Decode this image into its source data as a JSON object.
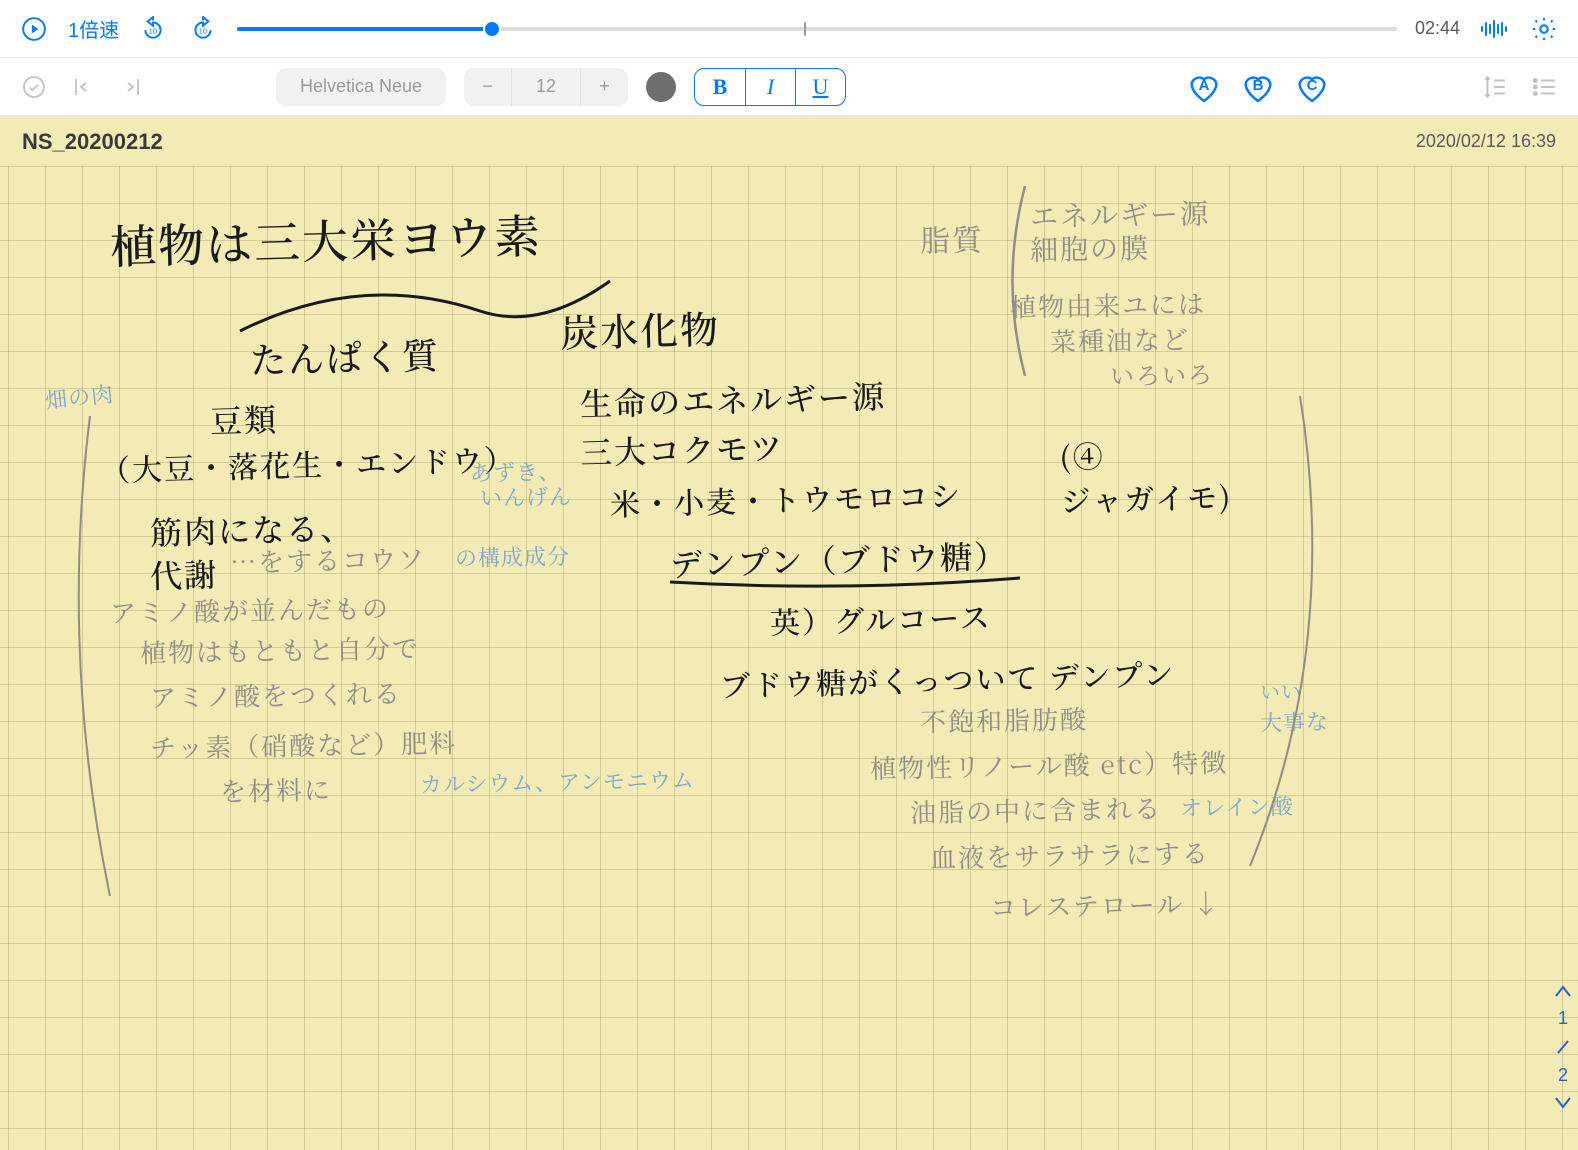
{
  "playback": {
    "speed_label": "1倍速",
    "time_label": "02:44",
    "progress_percent": 22,
    "marker_percent": 49
  },
  "format": {
    "font_name": "Helvetica Neue",
    "font_size": "12",
    "bold_label": "B",
    "italic_label": "I",
    "underline_label": "U",
    "heart_a": "A",
    "heart_b": "B",
    "heart_c": "C"
  },
  "note": {
    "title": "NS_20200212",
    "timestamp": "2020/02/12 16:39"
  },
  "handwriting": {
    "title": "植物は三大栄ヨウ素",
    "protein_label": "たんぱく質",
    "carb_label": "炭水化物",
    "beans": "豆類",
    "beans_examples": "（大豆・落花生・エンドウ）",
    "muscle": "筋肉になる、",
    "metabolism": "代謝",
    "energy_source": "生命のエネルギー源",
    "three_grains": "三大コクモツ",
    "grains_examples": "米・小麦・トウモロコシ",
    "potato": "ジャガイモ",
    "starch": "デンプン（ブドウ糖）",
    "glucose_en": "英）グルコース",
    "glucose_chain": "ブドウ糖がくっついて デンプン"
  },
  "pencil": {
    "fat_label": "脂質",
    "fat_energy": "エネルギー源",
    "fat_membrane": "細胞の膜",
    "plant_oil1": "植物由来ユには",
    "plant_oil2": "菜種油など",
    "plant_oil3": "いろいろ",
    "enzyme": "…をするコウソ",
    "amino1": "アミノ酸が並んだもの",
    "amino2": "植物はもともと自分で",
    "amino3": "アミノ酸をつくれる",
    "nitrogen": "チッ素（硝酸など）肥料",
    "material": "を材料に",
    "unsat_fat": "不飽和脂肪酸",
    "linoleic": "植物性リノール酸 etc）特徴",
    "fat_in_blood": "油脂の中に含まれる",
    "blood_smooth": "血液をサラサラにする",
    "cholesterol": "コレステロール ↓"
  },
  "bluepencil": {
    "field_meat": "畑の肉",
    "azuki": "あずき、",
    "ingen": "いんげん",
    "components": "の構成成分",
    "calcium": "カルシウム、アンモニウム",
    "oleic": "オレイン酸",
    "good": "いい",
    "big": "大事な"
  },
  "pagemarks": {
    "p1": "1",
    "p2": "2"
  }
}
